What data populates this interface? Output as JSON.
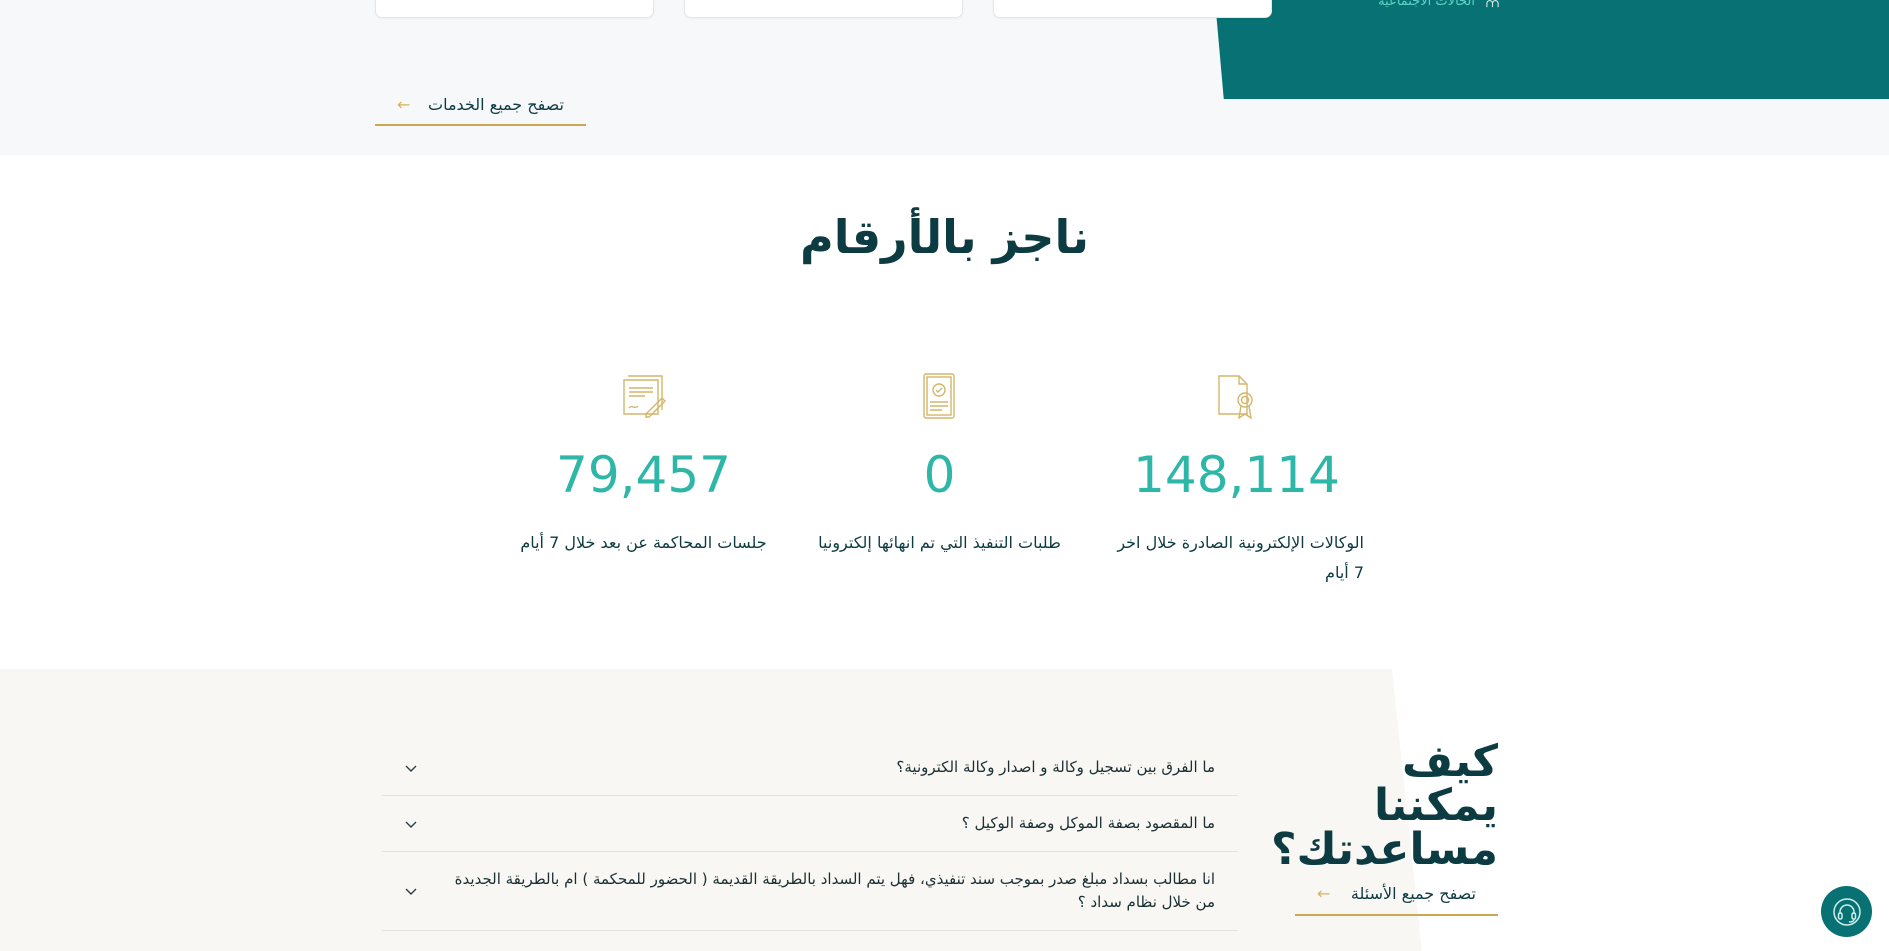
{
  "services": {
    "cards": [
      "",
      "",
      ""
    ],
    "teal_link_label": "الحالات الاجتماعية",
    "browse_label": "تصفح جميع الخدمات"
  },
  "stats": {
    "title": "ناجز بالأرقام",
    "items": [
      {
        "icon": "certificate-icon",
        "number": "148,114",
        "label": "الوكالات الإلكترونية الصادرة خلال اخر 7 أيام"
      },
      {
        "icon": "approved-document-icon",
        "number": "0",
        "label": "طلبات التنفيذ التي تم انهائها إلكترونيا"
      },
      {
        "icon": "contract-sign-icon",
        "number": "79,457",
        "label": "جلسات المحاكمة عن بعد خلال 7 أيام"
      }
    ]
  },
  "help": {
    "title": "كيف يمكننا مساعدتك؟",
    "browse_label": "تصفح جميع الأسئلة",
    "faqs": [
      "ما الفرق بين تسجيل وكالة و اصدار وكالة الكترونية؟",
      "ما المقصود بصفة الموكل وصفة الوكيل ؟",
      "انا مطالب بسداد مبلغ صدر بموجب سند تنفيذي، فهل يتم السداد بالطريقة القديمة ( الحضور للمحكمة ) ام بالطريقة الجديدة من خلال نظام سداد ؟"
    ]
  },
  "colors": {
    "teal": "#087173",
    "accent_number": "#2eb7a8",
    "gold": "#caa952",
    "dark_text": "#0c3b42"
  }
}
